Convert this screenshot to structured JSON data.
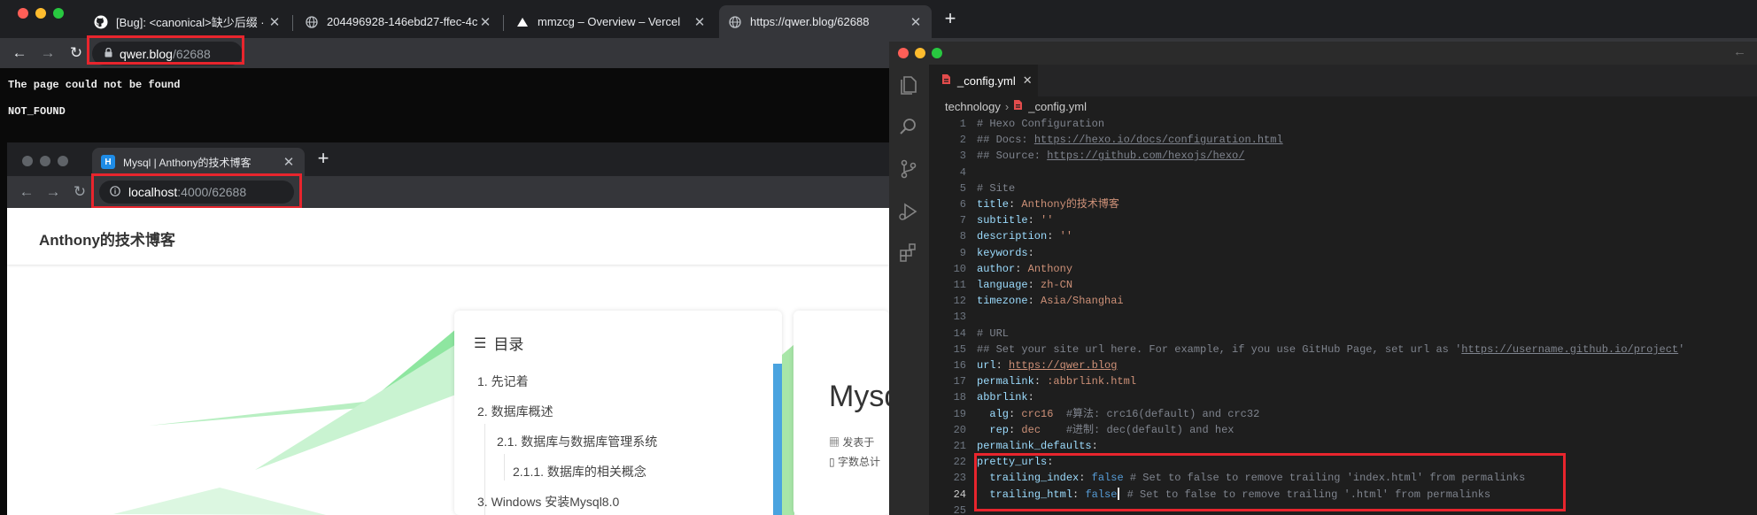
{
  "main_browser": {
    "tabs": [
      {
        "title": "[Bug]: <canonical>缺少后缀 · Is",
        "icon": "github-icon"
      },
      {
        "title": "204496928-146ebd27-ffec-4c",
        "icon": "globe-icon"
      },
      {
        "title": "mmzcg – Overview – Vercel",
        "icon": "vercel-icon"
      },
      {
        "title": "https://qwer.blog/62688",
        "icon": "globe-icon"
      }
    ],
    "url_host": "qwer.blog",
    "url_path": "/62688",
    "page_message": "The page could not be found",
    "page_code": "NOT_FOUND"
  },
  "inner_browser": {
    "tab_title": "Mysql | Anthony的技术博客",
    "tab_icon_letter": "H",
    "url_host": "localhost",
    "url_path": ":4000/62688",
    "blog_title": "Anthony的技术博客",
    "toc_heading": "目录",
    "toc_items": [
      "1. 先记着",
      "2. 数据库概述",
      "2.1. 数据库与数据库管理系统",
      "2.1.1. 数据库的相关概念",
      "3. Windows 安装Mysql8.0"
    ],
    "article_title_partial": "Mysq",
    "meta_published": "发表于",
    "meta_wordcount": "字数总计"
  },
  "vscode": {
    "tab_filename": "_config.yml",
    "breadcrumb_folder": "technology",
    "breadcrumb_file": "_config.yml",
    "lines": [
      {
        "n": "1",
        "segs": [
          [
            "cmt",
            "# Hexo Configuration"
          ]
        ]
      },
      {
        "n": "2",
        "segs": [
          [
            "cmt",
            "## Docs: "
          ],
          [
            "cmtlink",
            "https://hexo.io/docs/configuration.html"
          ]
        ]
      },
      {
        "n": "3",
        "segs": [
          [
            "cmt",
            "## Source: "
          ],
          [
            "cmtlink",
            "https://github.com/hexojs/hexo/"
          ]
        ]
      },
      {
        "n": "4",
        "segs": []
      },
      {
        "n": "5",
        "segs": [
          [
            "cmt",
            "# Site"
          ]
        ]
      },
      {
        "n": "6",
        "segs": [
          [
            "key",
            "title"
          ],
          [
            "plain",
            ": "
          ],
          [
            "str",
            "Anthony的技术博客"
          ]
        ]
      },
      {
        "n": "7",
        "segs": [
          [
            "key",
            "subtitle"
          ],
          [
            "plain",
            ": "
          ],
          [
            "str",
            "''"
          ]
        ]
      },
      {
        "n": "8",
        "segs": [
          [
            "key",
            "description"
          ],
          [
            "plain",
            ": "
          ],
          [
            "str",
            "''"
          ]
        ]
      },
      {
        "n": "9",
        "segs": [
          [
            "key",
            "keywords"
          ],
          [
            "plain",
            ":"
          ]
        ]
      },
      {
        "n": "10",
        "segs": [
          [
            "key",
            "author"
          ],
          [
            "plain",
            ": "
          ],
          [
            "str",
            "Anthony"
          ]
        ]
      },
      {
        "n": "11",
        "segs": [
          [
            "key",
            "language"
          ],
          [
            "plain",
            ": "
          ],
          [
            "str",
            "zh-CN"
          ]
        ]
      },
      {
        "n": "12",
        "segs": [
          [
            "key",
            "timezone"
          ],
          [
            "plain",
            ": "
          ],
          [
            "str",
            "Asia/Shanghai"
          ]
        ]
      },
      {
        "n": "13",
        "segs": []
      },
      {
        "n": "14",
        "segs": [
          [
            "cmt",
            "# URL"
          ]
        ]
      },
      {
        "n": "15",
        "segs": [
          [
            "cmt",
            "## Set your site url here. For example, if you use GitHub Page, set url as '"
          ],
          [
            "cmtlink",
            "https://username.github.io/project"
          ],
          [
            "cmt",
            "'"
          ]
        ]
      },
      {
        "n": "16",
        "segs": [
          [
            "key",
            "url"
          ],
          [
            "plain",
            ": "
          ],
          [
            "link",
            "https://qwer.blog"
          ]
        ]
      },
      {
        "n": "17",
        "segs": [
          [
            "key",
            "permalink"
          ],
          [
            "plain",
            ": "
          ],
          [
            "str",
            ":abbrlink.html"
          ]
        ]
      },
      {
        "n": "18",
        "segs": [
          [
            "key",
            "abbrlink"
          ],
          [
            "plain",
            ":"
          ]
        ]
      },
      {
        "n": "19",
        "segs": [
          [
            "plain",
            "  "
          ],
          [
            "key",
            "alg"
          ],
          [
            "plain",
            ": "
          ],
          [
            "str",
            "crc16"
          ],
          [
            "plain",
            "  "
          ],
          [
            "cmt",
            "#算法: crc16(default) and crc32"
          ]
        ]
      },
      {
        "n": "20",
        "segs": [
          [
            "plain",
            "  "
          ],
          [
            "key",
            "rep"
          ],
          [
            "plain",
            ": "
          ],
          [
            "str",
            "dec"
          ],
          [
            "plain",
            "    "
          ],
          [
            "cmt",
            "#进制: dec(default) and hex"
          ]
        ]
      },
      {
        "n": "21",
        "segs": [
          [
            "key",
            "permalink_defaults"
          ],
          [
            "plain",
            ":"
          ]
        ]
      },
      {
        "n": "22",
        "segs": [
          [
            "key",
            "pretty_urls"
          ],
          [
            "plain",
            ":"
          ]
        ]
      },
      {
        "n": "23",
        "segs": [
          [
            "plain",
            "  "
          ],
          [
            "key",
            "trailing_index"
          ],
          [
            "plain",
            ": "
          ],
          [
            "bool",
            "false"
          ],
          [
            "plain",
            " "
          ],
          [
            "cmt",
            "# Set to false to remove trailing 'index.html' from permalinks"
          ]
        ]
      },
      {
        "n": "24",
        "segs": [
          [
            "plain",
            "  "
          ],
          [
            "key",
            "trailing_html"
          ],
          [
            "plain",
            ": "
          ],
          [
            "bool",
            "false"
          ],
          [
            "caret",
            ""
          ],
          [
            "cmt",
            " # Set to false to remove trailing '.html' from permalinks"
          ]
        ]
      },
      {
        "n": "25",
        "segs": []
      }
    ],
    "current_line": "24"
  },
  "colors": {
    "highlight_red": "#e8252d",
    "accent_blue": "#4aa3df",
    "accent_green": "#9be39b"
  }
}
